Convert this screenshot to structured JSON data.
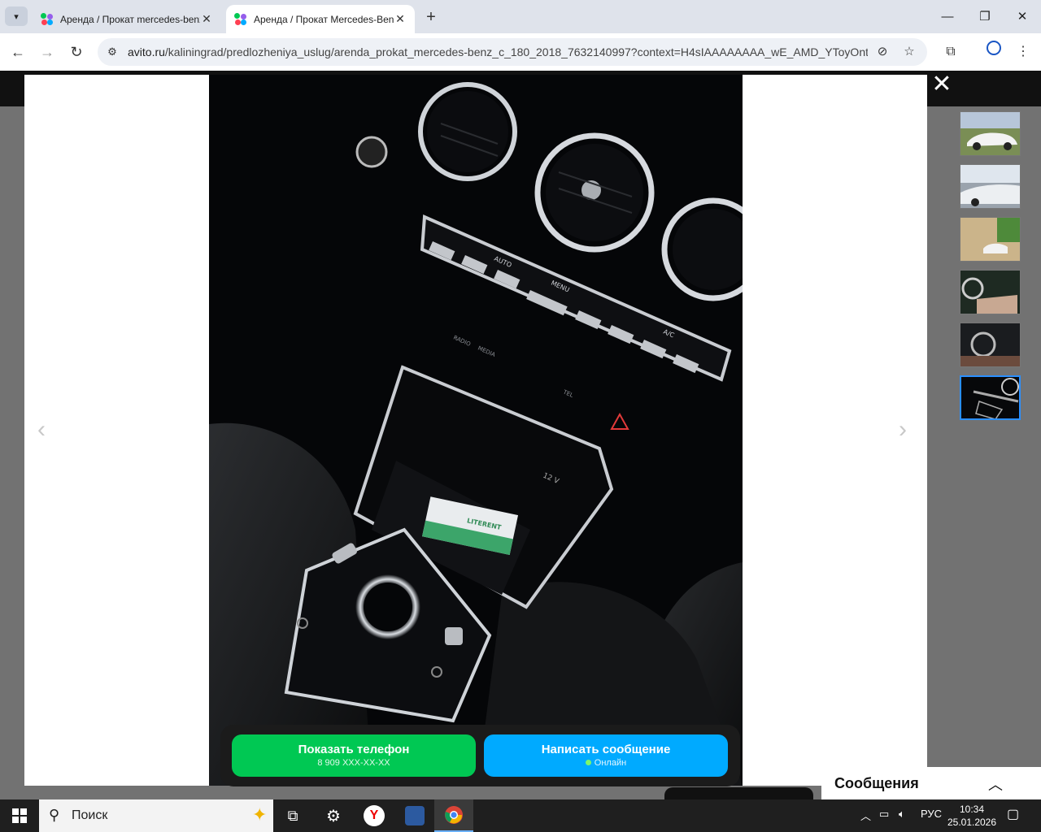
{
  "browser": {
    "tabs": [
      {
        "title": "Аренда / Прокат mercedes-benz",
        "active": false
      },
      {
        "title": "Аренда / Прокат Mercedes-Benz",
        "active": true
      }
    ],
    "url_host": "avito.ru",
    "url_path": "/kaliningrad/predlozheniya_uslug/arenda_prokat_mercedes-benz_c_180_2018_7632140997?context=H4sIAAAAAAAA_wE_AMD_YToyOntz...",
    "icons": {
      "tab_menu": "chevron-down-icon",
      "back": "back-arrow-icon",
      "forward": "forward-arrow-icon",
      "reload": "reload-icon",
      "site_info": "tune-icon",
      "tracking": "eye-off-icon",
      "bookmark": "star-icon",
      "extensions": "puzzle-icon",
      "profile": "profile-icon",
      "menu": "kebab-icon"
    }
  },
  "listing": {
    "phone_button": {
      "label": "Показать телефон",
      "sub": "8 909 XXX-XX-XX"
    },
    "message_button": {
      "label": "Написать сообщение",
      "status": "Онлайн"
    },
    "thumbnails_count": 6,
    "selected_thumbnail": 6,
    "photo_card_brand": "LITERENT",
    "photo_console_labels": [
      "AUTO",
      "MENU",
      "A/C",
      "RADIO",
      "MEDIA",
      "TEL",
      "12 V"
    ]
  },
  "chat_widget": {
    "label": "Сообщения"
  },
  "taskbar": {
    "search_placeholder": "Поиск",
    "language": "РУС",
    "time": "10:34",
    "date": "25.01.2026"
  },
  "colors": {
    "phone_button": "#00c853",
    "message_button": "#00aaff",
    "thumbnail_selected": "#2a8fff"
  }
}
